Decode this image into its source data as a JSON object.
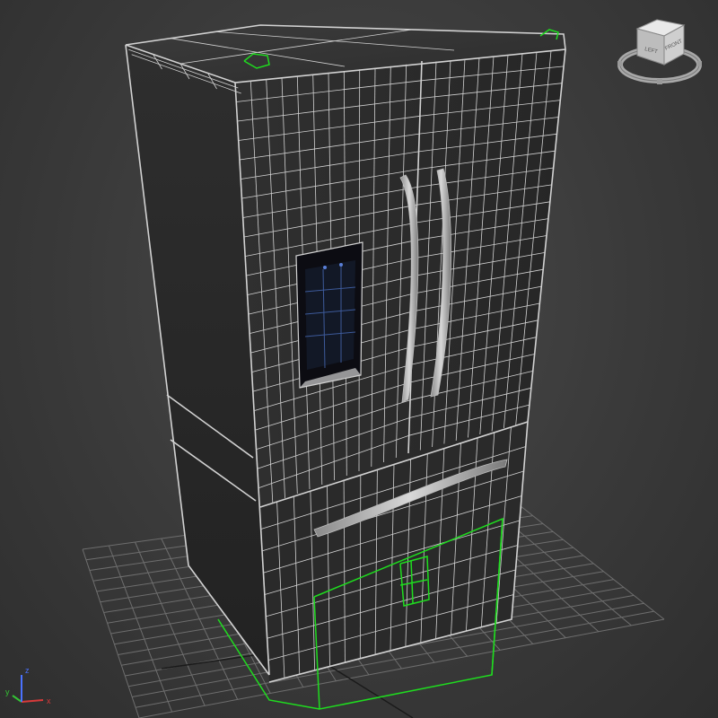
{
  "viewport": {
    "view_mode": "Perspective",
    "shading": "Shaded + Edged Faces",
    "background_color": "#3a3a3a",
    "grid_color": "#6e6e6e",
    "wire_color": "#d2d2d2",
    "selection_color": "#1fdc1f"
  },
  "viewcube": {
    "face_left_label": "LEFT",
    "face_front_label": "FRONT"
  },
  "axis_tripod": {
    "x_label": "x",
    "y_label": "y",
    "z_label": "z",
    "x_color": "#d83a3a",
    "y_color": "#34c234",
    "z_color": "#4a72ff"
  }
}
